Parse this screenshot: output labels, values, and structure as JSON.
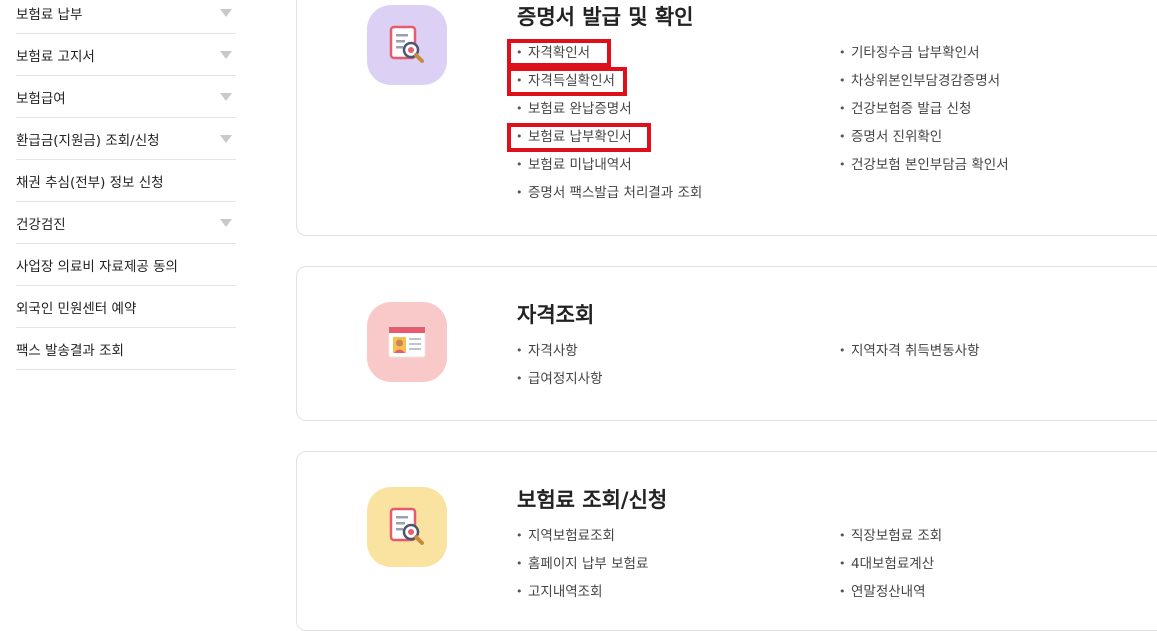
{
  "sidebar": {
    "items": [
      {
        "label": "보험료 납부",
        "has_arrow": true
      },
      {
        "label": "보험료 고지서",
        "has_arrow": true
      },
      {
        "label": "보험급여",
        "has_arrow": true
      },
      {
        "label": "환급금(지원금) 조회/신청",
        "has_arrow": true
      },
      {
        "label": "채권 추심(전부) 정보 신청",
        "has_arrow": false
      },
      {
        "label": "건강검진",
        "has_arrow": true
      },
      {
        "label": "사업장 의료비 자료제공 동의",
        "has_arrow": false
      },
      {
        "label": "외국인 민원센터 예약",
        "has_arrow": false
      },
      {
        "label": "팩스 발송결과 조회",
        "has_arrow": false
      }
    ]
  },
  "cards": {
    "certificate": {
      "title": "증명서 발급 및 확인",
      "icon": "document-search-icon",
      "icon_bg": "#dcd0f5",
      "left_links": [
        "자격확인서",
        "자격득실확인서",
        "보험료 완납증명서",
        "보험료 납부확인서",
        "보험료 미납내역서",
        "증명서 팩스발급 처리결과 조회"
      ],
      "right_links": [
        "기타징수금 납부확인서",
        "차상위본인부담경감증명서",
        "건강보험증 발급 신청",
        "증명서 진위확인",
        "건강보험 본인부담금 확인서"
      ]
    },
    "eligibility": {
      "title": "자격조회",
      "icon": "id-card-icon",
      "icon_bg": "#f9c9c9",
      "left_links": [
        "자격사항",
        "급여정지사항"
      ],
      "right_links": [
        "지역자격 취득변동사항"
      ]
    },
    "premium": {
      "title": "보험료 조회/신청",
      "icon": "document-search-icon",
      "icon_bg": "#fae3a0",
      "left_links": [
        "지역보험료조회",
        "홈페이지 납부 보험료",
        "고지내역조회"
      ],
      "right_links": [
        "직장보험료 조회",
        "4대보험료계산",
        "연말정산내역"
      ]
    }
  },
  "highlight_color": "#e0101a"
}
